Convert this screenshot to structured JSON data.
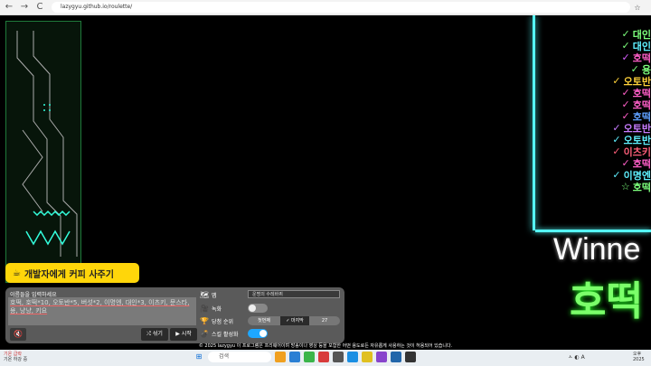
{
  "browser": {
    "url": "lazygyu.github.io/roulette/",
    "back": "←",
    "forward": "→",
    "reload": "C",
    "star": "☆"
  },
  "ranking": [
    {
      "check": "✓",
      "name": "대인",
      "color": "#7dff7d",
      "checkColor": "#7dff7d"
    },
    {
      "check": "✓",
      "name": "대인",
      "color": "#5ff0ff",
      "checkColor": "#7dff7d"
    },
    {
      "check": "✓",
      "name": "호떡",
      "color": "#ff5fc8",
      "checkColor": "#d95fff"
    },
    {
      "check": "✓",
      "name": "용",
      "color": "#7dff7d",
      "checkColor": "#7dff7d"
    },
    {
      "check": "✓",
      "name": "오토반",
      "color": "#ffd23a",
      "checkColor": "#ffd23a"
    },
    {
      "check": "✓",
      "name": "호떡",
      "color": "#ff5fc8",
      "checkColor": "#ff5fc8"
    },
    {
      "check": "✓",
      "name": "호떡",
      "color": "#ff5fc8",
      "checkColor": "#ff5fc8"
    },
    {
      "check": "✓",
      "name": "호떡",
      "color": "#5fa0ff",
      "checkColor": "#ff5fc8"
    },
    {
      "check": "✓",
      "name": "오토반",
      "color": "#c87dff",
      "checkColor": "#c87dff"
    },
    {
      "check": "✓",
      "name": "오토반",
      "color": "#5ff0ff",
      "checkColor": "#5ff0ff"
    },
    {
      "check": "✓",
      "name": "이츠키",
      "color": "#ff5f7a",
      "checkColor": "#ff5f7a"
    },
    {
      "check": "✓",
      "name": "호떡",
      "color": "#ff5fc8",
      "checkColor": "#ff5fc8"
    },
    {
      "check": "✓",
      "name": "이명엔",
      "color": "#5ff0ff",
      "checkColor": "#5ff0ff"
    },
    {
      "check": "☆",
      "name": "호떡",
      "color": "#7dff7d",
      "checkColor": "#7dff7d"
    }
  ],
  "winner": {
    "label": "Winne",
    "name": "호떡"
  },
  "coffee_button": {
    "label": "개발자에게 커피 사주기",
    "icon": "☕"
  },
  "panel": {
    "names_label": "이름들을 입력하세요",
    "names_value": "호떡, 호떡*10, 오토반*5, 버섯*2, 이명엔, 대인*3, 이츠키, 문스타, 용, 냥냥, 키요",
    "mute_icon": "🔇",
    "shuffle_label": "⤮ 섞기",
    "start_label": "▶ 시작",
    "options": {
      "map_label": "맵",
      "map_icon": "🗺",
      "map_value": "운명의 수레바퀴",
      "record_label": "녹화",
      "record_icon": "🎥",
      "rank_label": "당첨 순위",
      "rank_icon": "🏆",
      "rank_first": "첫번째",
      "rank_last": "✓ 마지막",
      "rank_number": "27",
      "skill_label": "스킬 활성화",
      "skill_icon": "💣"
    }
  },
  "footer_note": "© 2025 lazygyu 이 프로그램은 프리웨어이며 방송이나 영상 등을 포함한 어떤 용도로든 자유롭게 사용하는 것이 허용되어 있습니다.",
  "taskbar": {
    "weather_line1": "기온 급락",
    "weather_line2": "기온 하강 중",
    "search_placeholder": "검색",
    "start_icon": "⊞",
    "tray_text": "ㅅ ◐ A",
    "clock_time": "오후",
    "clock_date": "2025"
  }
}
